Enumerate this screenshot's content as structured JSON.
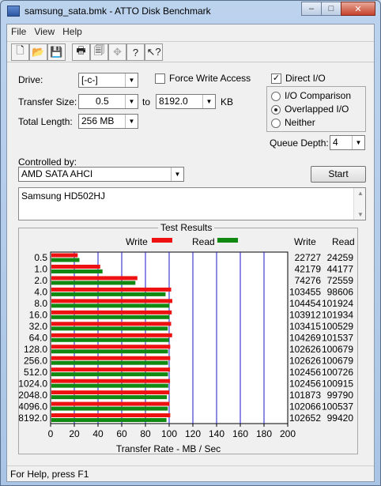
{
  "window": {
    "title": "samsung_sata.bmk - ATTO Disk Benchmark",
    "minimize_glyph": "–",
    "maximize_glyph": "□",
    "close_glyph": "✕"
  },
  "menu": [
    "File",
    "View",
    "Help"
  ],
  "toolbar": {
    "icons": [
      "new-icon",
      "open-icon",
      "save-icon",
      "print-icon",
      "print-preview-icon",
      "move-icon",
      "help-icon",
      "context-help-icon"
    ],
    "glyphs": [
      "🗋",
      "📂",
      "💾",
      "🖶",
      "🗐",
      "✥",
      "?",
      "↖?"
    ]
  },
  "settings": {
    "drive_label": "Drive:",
    "drive_value": "[-c-]",
    "force_write_label": "Force Write Access",
    "force_write_checked": false,
    "transfer_size_label": "Transfer Size:",
    "transfer_from": "0.5",
    "to_label": "to",
    "transfer_to": "8192.0",
    "kb_label": "KB",
    "total_length_label": "Total Length:",
    "total_length_value": "256 MB",
    "direct_io_label": "Direct I/O",
    "direct_io_checked": true,
    "io_comparison_label": "I/O Comparison",
    "overlapped_io_label": "Overlapped I/O",
    "neither_label": "Neither",
    "io_mode_selected": "Overlapped I/O",
    "queue_depth_label": "Queue Depth:",
    "queue_depth_value": "4",
    "controlled_by_label": "Controlled by:",
    "controller_value": "AMD SATA AHCI",
    "start_label": "Start",
    "description": "Samsung HD502HJ",
    "combo_arrow": "▼",
    "check_glyph": "✓",
    "scroll_up": "▲",
    "scroll_down": "▼"
  },
  "results": {
    "title": "Test Results",
    "write_legend": "Write",
    "read_legend": "Read",
    "write_col": "Write",
    "read_col": "Read"
  },
  "chart_data": {
    "type": "bar",
    "orientation": "horizontal",
    "categories": [
      "0.5",
      "1.0",
      "2.0",
      "4.0",
      "8.0",
      "16.0",
      "32.0",
      "64.0",
      "128.0",
      "256.0",
      "512.0",
      "1024.0",
      "2048.0",
      "4096.0",
      "8192.0"
    ],
    "series": [
      {
        "name": "Write",
        "color": "#ee1111",
        "values": [
          22727,
          42179,
          74276,
          103455,
          104454,
          103912,
          103415,
          104269,
          102626,
          102626,
          102456,
          102456,
          101873,
          102066,
          102652
        ]
      },
      {
        "name": "Read",
        "color": "#118811",
        "values": [
          24259,
          44177,
          72559,
          98606,
          101924,
          101934,
          100529,
          101537,
          100679,
          100679,
          100726,
          100915,
          99790,
          100537,
          99420
        ]
      }
    ],
    "xlabel": "Transfer Rate - MB / Sec",
    "xticks": [
      "0",
      "20",
      "40",
      "60",
      "80",
      "100",
      "120",
      "140",
      "160",
      "180",
      "200"
    ],
    "xlim": [
      0,
      200
    ],
    "grid": true
  },
  "status": {
    "text": "For Help, press F1"
  }
}
